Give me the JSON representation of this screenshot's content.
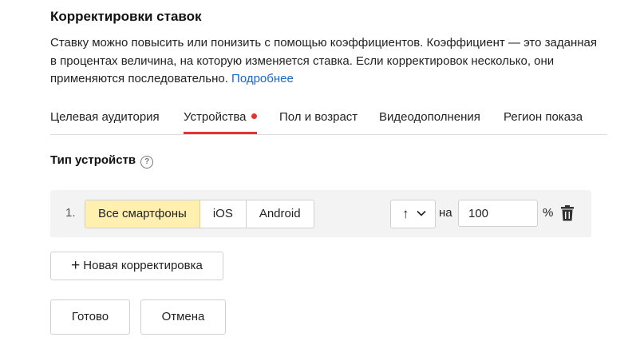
{
  "title": "Корректировки ставок",
  "description": {
    "text": "Ставку можно повысить или понизить с помощью коэффициентов. Коэффициент — это заданная в процентах величина, на которую изменяется ставка. Если корректировок несколько, они применяются последовательно. ",
    "more_link": "Подробнее"
  },
  "tabs": [
    {
      "label": "Целевая аудитория",
      "active": false
    },
    {
      "label": "Устройства",
      "active": true,
      "has_dot": true
    },
    {
      "label": "Пол и возраст",
      "active": false
    },
    {
      "label": "Видеодополнения",
      "active": false
    },
    {
      "label": "Регион показа",
      "active": false
    }
  ],
  "device_type": {
    "label": "Тип устройств",
    "help_icon": "question-circle-icon"
  },
  "adjustment": {
    "number": "1.",
    "options": [
      "Все смартфоны",
      "iOS",
      "Android"
    ],
    "selected": "Все смартфоны",
    "direction_symbol": "↑",
    "direction_icon": "arrow-up-icon",
    "na_label": "на",
    "value": "100",
    "percent_label": "%",
    "delete_icon": "trash-icon"
  },
  "buttons": {
    "add_icon": "plus-icon",
    "add_label": "Новая корректировка",
    "done_label": "Готово",
    "cancel_label": "Отмена"
  },
  "colors": {
    "accent_red": "#e8322e",
    "link_blue": "#1a66c9",
    "selected_bg": "#fff0b0",
    "row_bg": "#f3f3f3"
  }
}
